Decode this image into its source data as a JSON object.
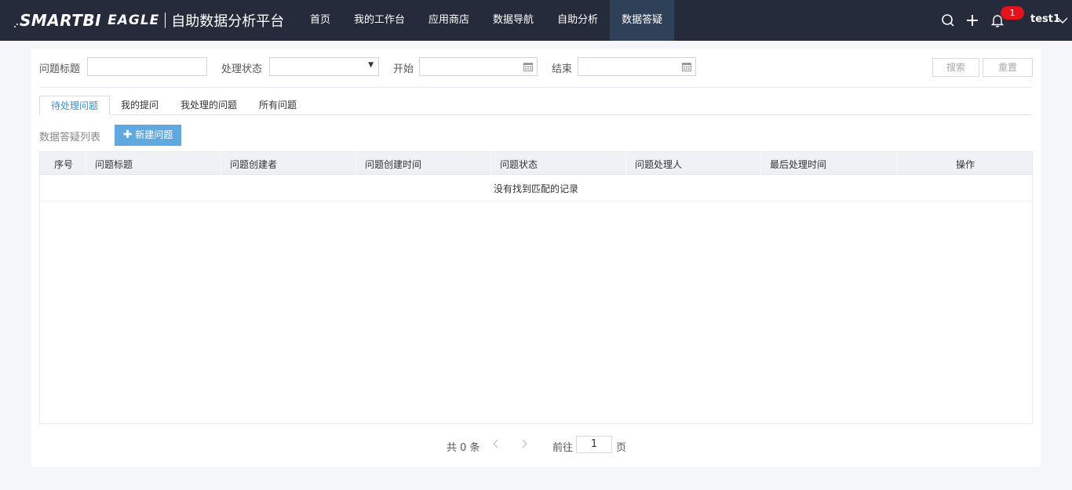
{
  "header": {
    "logo_smart": "SMARTBI",
    "logo_eagle": "EAGLE",
    "logo_cn": "自助数据分析平台",
    "nav": [
      {
        "label": "首页"
      },
      {
        "label": "我的工作台"
      },
      {
        "label": "应用商店"
      },
      {
        "label": "数据导航"
      },
      {
        "label": "自助分析"
      },
      {
        "label": "数据答疑"
      }
    ],
    "active_nav": "数据答疑",
    "notification_count": "1",
    "user": "test1",
    "icons": [
      "search-icon",
      "plus-icon",
      "bell-icon",
      "chevron-down-icon"
    ]
  },
  "filters": {
    "title_label": "问题标题",
    "title_value": "",
    "status_label": "处理状态",
    "status_value": "",
    "start_label": "开始",
    "start_value": "",
    "end_label": "结束",
    "end_value": "",
    "search_button": "搜索",
    "reset_button": "重置"
  },
  "tabs": [
    {
      "label": "待处理问题"
    },
    {
      "label": "我的提问"
    },
    {
      "label": "我处理的问题"
    },
    {
      "label": "所有问题"
    }
  ],
  "active_tab": "待处理问题",
  "list": {
    "title": "数据答疑列表",
    "new_button": "新建问题",
    "columns": [
      "序号",
      "问题标题",
      "问题创建者",
      "问题创建时间",
      "问题状态",
      "问题处理人",
      "最后处理时间",
      "操作"
    ],
    "empty_text": "没有找到匹配的记录"
  },
  "pagination": {
    "total": "共 0 条",
    "goto_label": "前往",
    "page": "1",
    "page_suffix": "页"
  },
  "colors": {
    "topbar": "#252b3a",
    "active_nav": "#2f4159",
    "accent": "#5fa9e0",
    "badge": "#e4121b"
  }
}
